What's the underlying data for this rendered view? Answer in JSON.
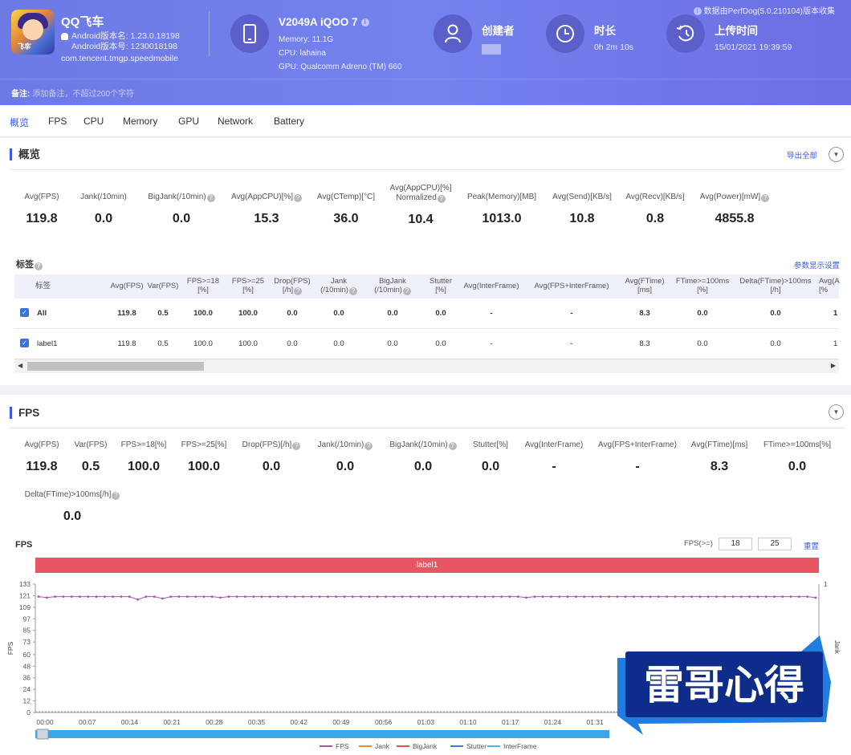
{
  "header": {
    "app_name": "QQ飞车",
    "android_version_name": "Android版本名: 1.23.0.18198",
    "android_version_code": "Android版本号: 1230018198",
    "package": "com.tencent.tmgp.speedmobile",
    "app_icon_text": "飞车",
    "device_name": "V2049A iQOO 7",
    "device_memory": "Memory: 11.1G",
    "device_cpu": "CPU: lahaina",
    "device_gpu": "GPU: Qualcomm Adreno (TM) 660",
    "creator_label": "创建者",
    "duration_label": "时长",
    "duration_value": "0h 2m 10s",
    "upload_label": "上传时间",
    "upload_value": "15/01/2021 19:39:59",
    "notice": "数据由PerfDog(5.0.210104)版本收集",
    "remark_label": "备注:",
    "remark_placeholder": "添加备注，不超过200个字符"
  },
  "tabs": [
    "概览",
    "FPS",
    "CPU",
    "Memory",
    "GPU",
    "Network",
    "Battery"
  ],
  "overview": {
    "title": "概览",
    "export_label": "导出全部",
    "metrics": [
      {
        "label": "Avg(FPS)",
        "value": "119.8"
      },
      {
        "label": "Jank(/10min)",
        "value": "0.0"
      },
      {
        "label": "BigJank(/10min)",
        "value": "0.0"
      },
      {
        "label": "Avg(AppCPU)[%]",
        "value": "15.3"
      },
      {
        "label": "Avg(CTemp)[°C]",
        "value": "36.0"
      },
      {
        "label": "Avg(AppCPU)[%]",
        "label2": "Normalized",
        "value": "10.4"
      },
      {
        "label": "Peak(Memory)[MB]",
        "value": "1013.0"
      },
      {
        "label": "Avg(Send)[KB/s]",
        "value": "10.8"
      },
      {
        "label": "Avg(Recv)[KB/s]",
        "value": "0.8"
      },
      {
        "label": "Avg(Power)[mW]",
        "value": "4855.8"
      }
    ],
    "tags_title": "标签",
    "param_settings": "参数显示设置",
    "table": {
      "headers": [
        {
          "l1": "标签",
          "l2": ""
        },
        {
          "l1": "Avg(FPS)",
          "l2": ""
        },
        {
          "l1": "Var(FPS)",
          "l2": ""
        },
        {
          "l1": "FPS>=18",
          "l2": "[%]"
        },
        {
          "l1": "FPS>=25",
          "l2": "[%]"
        },
        {
          "l1": "Drop(FPS)",
          "l2": "[/h]"
        },
        {
          "l1": "Jank",
          "l2": "(/10min)"
        },
        {
          "l1": "BigJank",
          "l2": "(/10min)"
        },
        {
          "l1": "Stutter",
          "l2": "[%]"
        },
        {
          "l1": "Avg(InterFrame)",
          "l2": ""
        },
        {
          "l1": "Avg(FPS+InterFrame)",
          "l2": ""
        },
        {
          "l1": "Avg(FTime)",
          "l2": "[ms]"
        },
        {
          "l1": "FTime>=100ms",
          "l2": "[%]"
        },
        {
          "l1": "Delta(FTime)>100ms",
          "l2": "[/h]"
        },
        {
          "l1": "Avg(A",
          "l2": "[%"
        }
      ],
      "rows": [
        {
          "cells": [
            "All",
            "119.8",
            "0.5",
            "100.0",
            "100.0",
            "0.0",
            "0.0",
            "0.0",
            "0.0",
            "-",
            "-",
            "8.3",
            "0.0",
            "0.0",
            "1"
          ]
        },
        {
          "cells": [
            "label1",
            "119.8",
            "0.5",
            "100.0",
            "100.0",
            "0.0",
            "0.0",
            "0.0",
            "0.0",
            "-",
            "-",
            "8.3",
            "0.0",
            "0.0",
            "1"
          ]
        }
      ]
    }
  },
  "fps_section": {
    "title": "FPS",
    "metrics": [
      {
        "label": "Avg(FPS)",
        "value": "119.8"
      },
      {
        "label": "Var(FPS)",
        "value": "0.5"
      },
      {
        "label": "FPS>=18[%]",
        "value": "100.0"
      },
      {
        "label": "FPS>=25[%]",
        "value": "100.0"
      },
      {
        "label": "Drop(FPS)[/h]",
        "value": "0.0"
      },
      {
        "label": "Jank(/10min)",
        "value": "0.0"
      },
      {
        "label": "BigJank(/10min)",
        "value": "0.0"
      },
      {
        "label": "Stutter[%]",
        "value": "0.0"
      },
      {
        "label": "Avg(InterFrame)",
        "value": "-"
      },
      {
        "label": "Avg(FPS+InterFrame)",
        "value": "-"
      },
      {
        "label": "Avg(FTime)[ms]",
        "value": "8.3"
      },
      {
        "label": "FTime>=100ms[%]",
        "value": "0.0"
      },
      {
        "label": "Delta(FTime)>100ms[/h]",
        "value": "0.0"
      }
    ],
    "chart_title": "FPS",
    "threshold_label": "FPS(>=)",
    "threshold_1": "18",
    "threshold_2": "25",
    "apply_label": "重置",
    "label_bar": "label1"
  },
  "chart_data": {
    "type": "line",
    "title": "FPS",
    "ylabel": "FPS",
    "y2label": "Jank",
    "ylim": [
      0,
      133
    ],
    "y_ticks": [
      "133",
      "121",
      "109",
      "97",
      "85",
      "73",
      "60",
      "48",
      "36",
      "24",
      "12",
      "0"
    ],
    "y2_ticks": [
      "1",
      "0"
    ],
    "x_ticks": [
      "00:00",
      "00:07",
      "00:14",
      "00:21",
      "00:28",
      "00:35",
      "00:42",
      "00:49",
      "00:56",
      "01:03",
      "01:10",
      "01:17",
      "01:24",
      "01:31"
    ],
    "series": [
      {
        "name": "FPS",
        "color": "#b44bb8",
        "values": [
          120,
          119,
          120,
          120,
          120,
          120,
          120,
          120,
          120,
          120,
          120,
          120,
          117,
          120,
          120,
          118,
          120,
          120,
          120,
          120,
          120,
          120,
          119,
          120,
          120,
          120,
          120,
          120,
          120,
          120,
          120,
          120,
          120,
          120,
          120,
          120,
          120,
          120,
          120,
          120,
          120,
          120,
          120,
          120,
          120,
          120,
          120,
          120,
          120,
          120,
          120,
          120,
          120,
          120,
          120,
          120,
          120,
          120,
          120,
          119,
          120,
          120,
          120,
          120,
          120,
          120,
          120,
          120,
          120,
          120,
          120,
          120,
          120,
          120,
          120,
          120,
          120,
          120,
          120,
          120,
          120,
          120,
          120,
          120,
          120,
          120,
          120,
          120,
          120,
          120,
          120,
          120,
          120,
          120,
          119
        ]
      },
      {
        "name": "Jank",
        "color": "#f28c28",
        "values": []
      },
      {
        "name": "BigJank",
        "color": "#e8543a",
        "values": []
      },
      {
        "name": "Stutter",
        "color": "#3c7bd8",
        "values": []
      },
      {
        "name": "InterFrame",
        "color": "#4ab8e6",
        "values": []
      }
    ],
    "legend": "bottom"
  },
  "watermark": "雷哥心得"
}
